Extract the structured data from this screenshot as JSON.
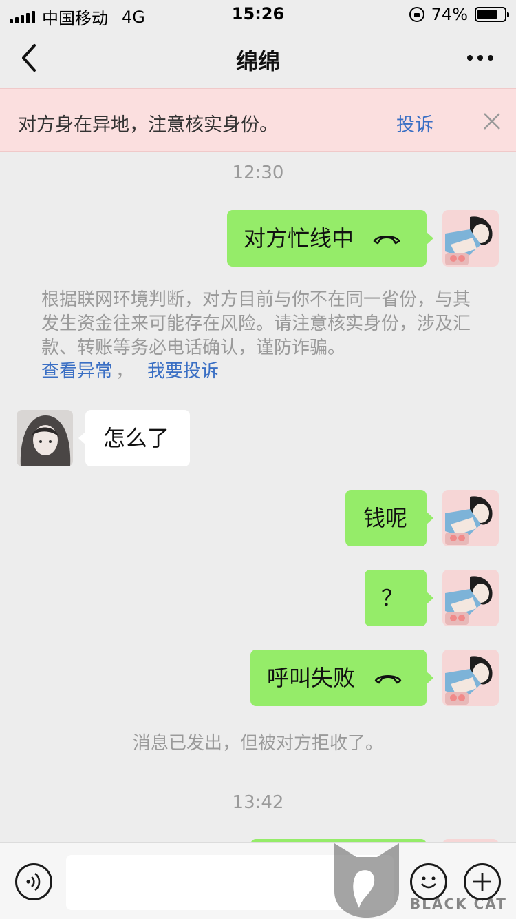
{
  "status_bar": {
    "carrier": "中国移动",
    "network": "4G",
    "time": "15:26",
    "battery_percent": "74%",
    "battery_level": 0.74
  },
  "nav": {
    "title": "绵绵",
    "back_icon": "chevron-left-icon",
    "more_icon": "more-dots-icon"
  },
  "banner": {
    "text": "对方身在异地，注意核实身份。",
    "report_label": "投诉",
    "close_icon": "close-icon"
  },
  "chat": {
    "timestamp_1": "12:30",
    "msg_call_busy": "对方忙线中",
    "notice_text": "根据联网环境判断，对方目前与你不在同一省份，与其发生资金往来可能存在风险。请注意核实身份，涉及汇款、转账等务必电话确认，谨防诈骗。",
    "notice_link_1": "查看异常",
    "notice_sep": "，",
    "notice_link_2": "我要投诉",
    "msg_them_1": "怎么了",
    "msg_me_2": "钱呢",
    "msg_me_3": "？",
    "msg_call_failed": "呼叫失败",
    "rejected_notice": "消息已发出，但被对方拒收了。",
    "timestamp_2": "13:42"
  },
  "input_bar": {
    "value": "",
    "voice_icon": "voice-icon",
    "emoji_icon": "emoji-icon",
    "plus_icon": "plus-icon"
  },
  "watermark": {
    "brand_cn": "黑猫",
    "brand_en": "BLACK CAT"
  },
  "colors": {
    "background": "#ededed",
    "my_bubble": "#95ec69",
    "their_bubble": "#ffffff",
    "banner_bg": "#fbdfdf",
    "link": "#3a6fc4",
    "muted_text": "#9a9a9a"
  }
}
